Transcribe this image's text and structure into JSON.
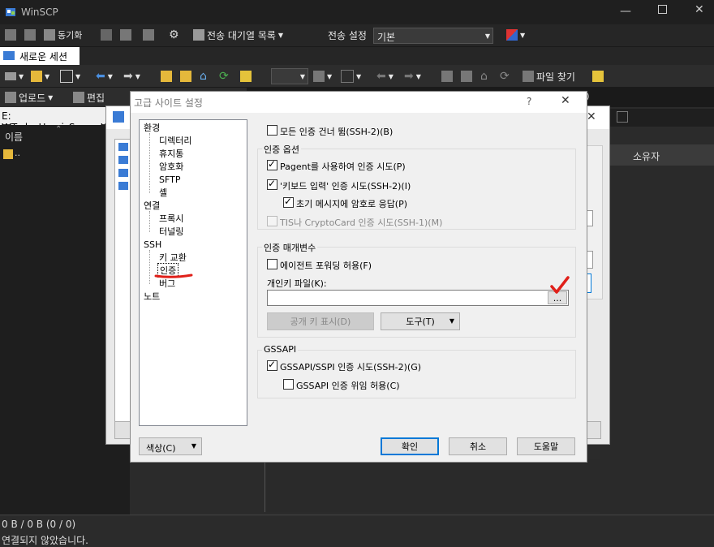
{
  "window": {
    "title": "WinSCP"
  },
  "toolbar1": {
    "sync_label": "동기화",
    "queue_label": "전송 대기열 목록",
    "transfer_settings_label": "전송 설정",
    "transfer_settings_value": "기본"
  },
  "session_tab": {
    "label": "새로운 세션"
  },
  "toolbar3": {
    "find_files_label": "파일 찾기"
  },
  "local_panel": {
    "upload_label": "업로드",
    "edit_label": "편집",
    "path": "E:₩Todo_Homi_Server₩",
    "column_name": "이름",
    "parent_dir": ".."
  },
  "remote_panel": {
    "column_owner": "소유자",
    "path_tail": "H)"
  },
  "status_bar": {
    "transfer": "0 B / 0 B (0 / 0)",
    "connection": "연결되지 않았습니다."
  },
  "dialog": {
    "title": "고급 사이트 설정",
    "help": "?",
    "close": "✕",
    "tree": {
      "env": "환경",
      "env_children": [
        "디렉터리",
        "휴지통",
        "암호화",
        "SFTP",
        "셸"
      ],
      "conn": "연결",
      "conn_children": [
        "프록시",
        "터널링"
      ],
      "ssh": "SSH",
      "ssh_children": [
        "키 교환",
        "인증",
        "버그"
      ],
      "notes": "노트"
    },
    "bypass_auth": "모든 인증 건너 뜀(SSH-2)(B)",
    "auth_options": {
      "title": "인증 옵션",
      "pageant": "Pagent를 사용하여 인증 시도(P)",
      "keyboard": "'키보드 입력' 인증 시도(SSH-2)(I)",
      "respond_password": "초기 메시지에 암호로 응답(P)",
      "tis": "TIS나 CryptoCard 인증 시도(SSH-1)(M)"
    },
    "auth_params": {
      "title": "인증 매개변수",
      "agent_forwarding": "에이전트 포워딩 허용(F)",
      "private_key_label": "개인키 파일(K):",
      "private_key_value": "",
      "browse": "...",
      "show_public_key": "공개 키 표시(D)",
      "tools": "도구(T)"
    },
    "gssapi": {
      "title": "GSSAPI",
      "attempt": "GSSAPI/SSPI 인증 시도(SSH-2)(G)",
      "delegation": "GSSAPI 인증 위임 허용(C)"
    },
    "color_button": "색상(C)",
    "ok": "확인",
    "cancel": "취소",
    "help_button": "도움말"
  },
  "colors": {
    "annotation_red": "#e0201a",
    "focus_blue": "#0078d7"
  }
}
